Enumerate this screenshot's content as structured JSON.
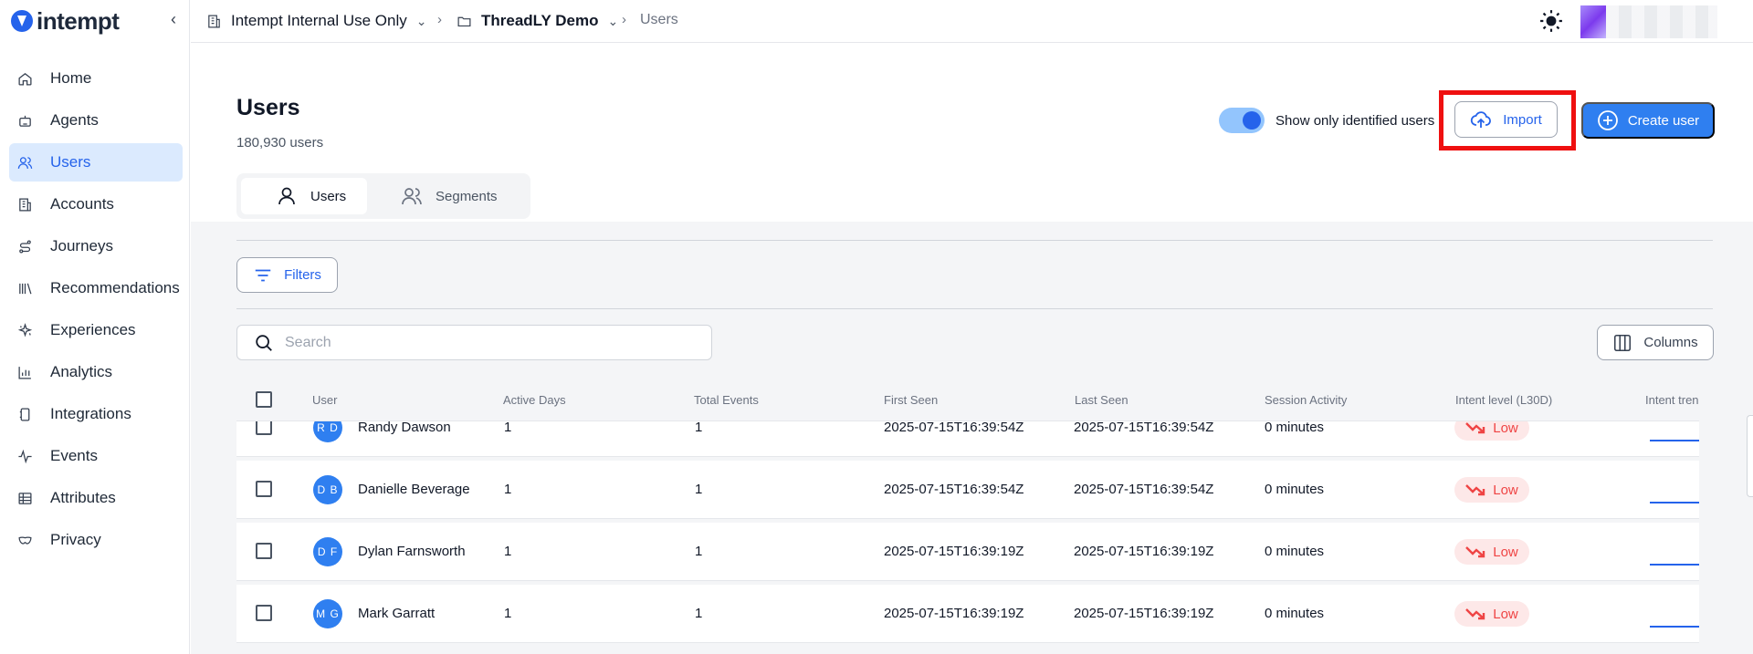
{
  "brand": {
    "name": "intempt"
  },
  "sidebar": {
    "items": [
      {
        "label": "Home",
        "icon": "home-icon",
        "active": false
      },
      {
        "label": "Agents",
        "icon": "robot-icon",
        "active": false
      },
      {
        "label": "Users",
        "icon": "users-icon",
        "active": true
      },
      {
        "label": "Accounts",
        "icon": "building-icon",
        "active": false
      },
      {
        "label": "Journeys",
        "icon": "route-icon",
        "active": false
      },
      {
        "label": "Recommendations",
        "icon": "library-icon",
        "active": false
      },
      {
        "label": "Experiences",
        "icon": "sparkle-icon",
        "active": false
      },
      {
        "label": "Analytics",
        "icon": "bar-chart-icon",
        "active": false
      },
      {
        "label": "Integrations",
        "icon": "plug-icon",
        "active": false
      },
      {
        "label": "Events",
        "icon": "activity-icon",
        "active": false
      },
      {
        "label": "Attributes",
        "icon": "table-icon",
        "active": false
      },
      {
        "label": "Privacy",
        "icon": "mask-icon",
        "active": false
      }
    ]
  },
  "breadcrumb": {
    "org": "Intempt Internal Use Only",
    "project": "ThreadLY Demo",
    "current": "Users"
  },
  "header": {
    "title": "Users",
    "count": "180,930 users",
    "toggle_label": "Show only identified users",
    "toggle_on": true,
    "import_label": "Import",
    "create_label": "Create user"
  },
  "tabs": [
    {
      "label": "Users",
      "active": true
    },
    {
      "label": "Segments",
      "active": false
    }
  ],
  "toolbar": {
    "filters_label": "Filters",
    "search_placeholder": "Search",
    "columns_label": "Columns"
  },
  "table": {
    "columns": [
      "User",
      "Active Days",
      "Total Events",
      "First Seen",
      "Last Seen",
      "Session Activity",
      "Intent level (L30D)",
      "Intent trend"
    ],
    "rows": [
      {
        "initials": "R D",
        "name": "Randy Dawson",
        "active_days": "1",
        "total_events": "1",
        "first_seen": "2025-07-15T16:39:54Z",
        "last_seen": "2025-07-15T16:39:54Z",
        "session": "0 minutes",
        "intent": "Low"
      },
      {
        "initials": "D B",
        "name": "Danielle Beverage",
        "active_days": "1",
        "total_events": "1",
        "first_seen": "2025-07-15T16:39:54Z",
        "last_seen": "2025-07-15T16:39:54Z",
        "session": "0 minutes",
        "intent": "Low"
      },
      {
        "initials": "D F",
        "name": "Dylan Farnsworth",
        "active_days": "1",
        "total_events": "1",
        "first_seen": "2025-07-15T16:39:19Z",
        "last_seen": "2025-07-15T16:39:19Z",
        "session": "0 minutes",
        "intent": "Low"
      },
      {
        "initials": "M G",
        "name": "Mark Garratt",
        "active_days": "1",
        "total_events": "1",
        "first_seen": "2025-07-15T16:39:19Z",
        "last_seen": "2025-07-15T16:39:19Z",
        "session": "0 minutes",
        "intent": "Low"
      }
    ]
  },
  "colors": {
    "accent": "#2563eb",
    "highlight": "#ef1010",
    "intent_low": "#ef4444"
  }
}
